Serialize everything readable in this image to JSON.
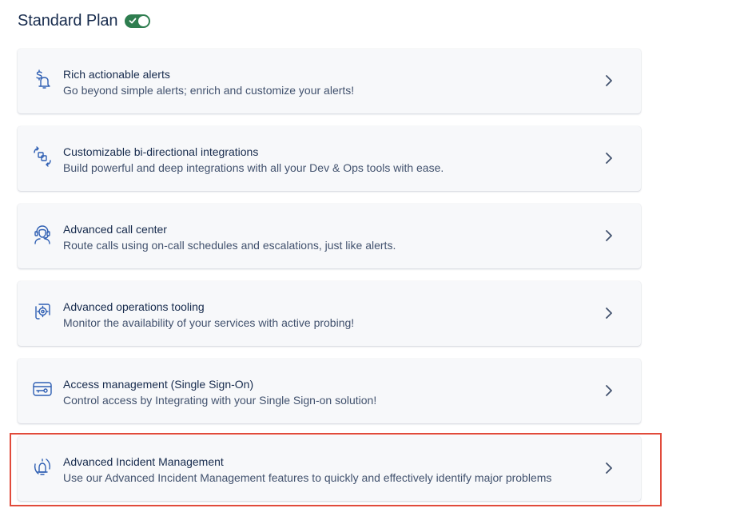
{
  "header": {
    "title": "Standard Plan",
    "toggle_state": "on"
  },
  "colors": {
    "toggle_on": "#2e7d4f",
    "highlight_border": "#e14b3b",
    "icon": "#2f5fb3"
  },
  "features": [
    {
      "title": "Rich actionable alerts",
      "description": "Go beyond simple alerts; enrich and customize your alerts!",
      "icon": "dollar-bell-icon"
    },
    {
      "title": "Customizable bi-directional integrations",
      "description": "Build powerful and deep integrations with all your Dev & Ops tools with ease.",
      "icon": "integration-arrows-icon"
    },
    {
      "title": "Advanced call center",
      "description": "Route calls using on-call schedules and escalations, just like alerts.",
      "icon": "headset-agent-icon"
    },
    {
      "title": "Advanced operations tooling",
      "description": "Monitor the availability of your services with active probing!",
      "icon": "gear-monitor-icon"
    },
    {
      "title": "Access management (Single Sign-On)",
      "description": "Control access by Integrating with your Single Sign-on solution!",
      "icon": "key-card-icon"
    },
    {
      "title": "Advanced Incident Management",
      "description": "Use our Advanced Incident Management features to quickly and effectively identify major problems",
      "icon": "incident-alarm-icon"
    }
  ]
}
